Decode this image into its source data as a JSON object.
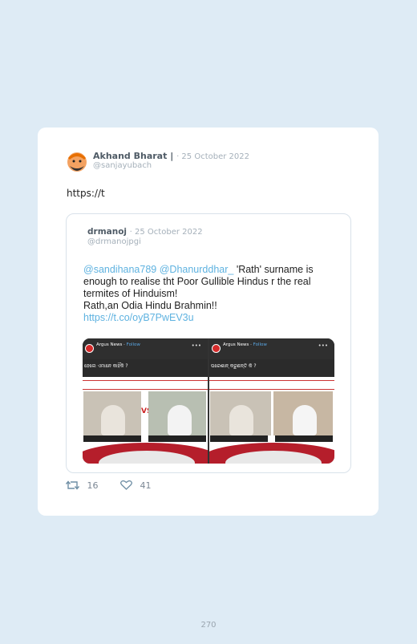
{
  "tweet": {
    "author_name": "Akhand Bharat |",
    "date": "· 25 October 2022",
    "handle": "@sanjayubach",
    "text": "https://t",
    "retweets": "16",
    "likes": "41"
  },
  "quoted": {
    "author_name": "drmanoj",
    "date": "· 25 October 2022",
    "handle": "@drmanojpgi",
    "mention1": "@sandihana789",
    "mention2": "@Dhanurddhar_",
    "text_line1": " 'Rath' surname is enough to realise tht Poor Gullible Hindus r the real termites of Hinduism!",
    "text_line2": "Rath,an Odia Hindu Brahmin!!",
    "link": "https://t.co/oyB7PwEV3u",
    "media": {
      "source_name": "Argus News",
      "follow": "Follow",
      "caption1": "ପରେଶାନ୍ କରୁଛନ୍ତି କି ?",
      "caption2": "ହେଲେ ଏମାନେ କାହିଁକି ?",
      "vs": "VS"
    }
  },
  "page_number": "270",
  "colors": {
    "background": "#deebf5",
    "card": "#ffffff",
    "link": "#5eb2e0"
  }
}
